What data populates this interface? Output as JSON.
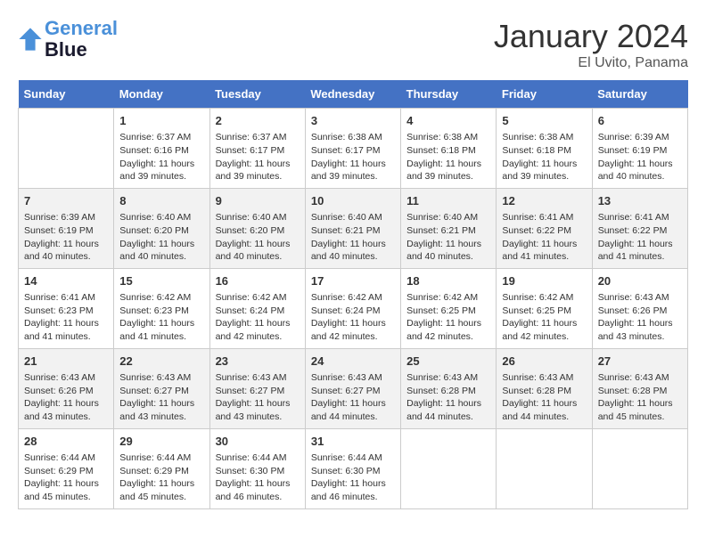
{
  "logo": {
    "line1": "General",
    "line2": "Blue"
  },
  "title": "January 2024",
  "location": "El Uvito, Panama",
  "days_of_week": [
    "Sunday",
    "Monday",
    "Tuesday",
    "Wednesday",
    "Thursday",
    "Friday",
    "Saturday"
  ],
  "weeks": [
    [
      {
        "day": "",
        "content": ""
      },
      {
        "day": "1",
        "content": "Sunrise: 6:37 AM\nSunset: 6:16 PM\nDaylight: 11 hours and 39 minutes."
      },
      {
        "day": "2",
        "content": "Sunrise: 6:37 AM\nSunset: 6:17 PM\nDaylight: 11 hours and 39 minutes."
      },
      {
        "day": "3",
        "content": "Sunrise: 6:38 AM\nSunset: 6:17 PM\nDaylight: 11 hours and 39 minutes."
      },
      {
        "day": "4",
        "content": "Sunrise: 6:38 AM\nSunset: 6:18 PM\nDaylight: 11 hours and 39 minutes."
      },
      {
        "day": "5",
        "content": "Sunrise: 6:38 AM\nSunset: 6:18 PM\nDaylight: 11 hours and 39 minutes."
      },
      {
        "day": "6",
        "content": "Sunrise: 6:39 AM\nSunset: 6:19 PM\nDaylight: 11 hours and 40 minutes."
      }
    ],
    [
      {
        "day": "7",
        "content": "Sunrise: 6:39 AM\nSunset: 6:19 PM\nDaylight: 11 hours and 40 minutes."
      },
      {
        "day": "8",
        "content": "Sunrise: 6:40 AM\nSunset: 6:20 PM\nDaylight: 11 hours and 40 minutes."
      },
      {
        "day": "9",
        "content": "Sunrise: 6:40 AM\nSunset: 6:20 PM\nDaylight: 11 hours and 40 minutes."
      },
      {
        "day": "10",
        "content": "Sunrise: 6:40 AM\nSunset: 6:21 PM\nDaylight: 11 hours and 40 minutes."
      },
      {
        "day": "11",
        "content": "Sunrise: 6:40 AM\nSunset: 6:21 PM\nDaylight: 11 hours and 40 minutes."
      },
      {
        "day": "12",
        "content": "Sunrise: 6:41 AM\nSunset: 6:22 PM\nDaylight: 11 hours and 41 minutes."
      },
      {
        "day": "13",
        "content": "Sunrise: 6:41 AM\nSunset: 6:22 PM\nDaylight: 11 hours and 41 minutes."
      }
    ],
    [
      {
        "day": "14",
        "content": "Sunrise: 6:41 AM\nSunset: 6:23 PM\nDaylight: 11 hours and 41 minutes."
      },
      {
        "day": "15",
        "content": "Sunrise: 6:42 AM\nSunset: 6:23 PM\nDaylight: 11 hours and 41 minutes."
      },
      {
        "day": "16",
        "content": "Sunrise: 6:42 AM\nSunset: 6:24 PM\nDaylight: 11 hours and 42 minutes."
      },
      {
        "day": "17",
        "content": "Sunrise: 6:42 AM\nSunset: 6:24 PM\nDaylight: 11 hours and 42 minutes."
      },
      {
        "day": "18",
        "content": "Sunrise: 6:42 AM\nSunset: 6:25 PM\nDaylight: 11 hours and 42 minutes."
      },
      {
        "day": "19",
        "content": "Sunrise: 6:42 AM\nSunset: 6:25 PM\nDaylight: 11 hours and 42 minutes."
      },
      {
        "day": "20",
        "content": "Sunrise: 6:43 AM\nSunset: 6:26 PM\nDaylight: 11 hours and 43 minutes."
      }
    ],
    [
      {
        "day": "21",
        "content": "Sunrise: 6:43 AM\nSunset: 6:26 PM\nDaylight: 11 hours and 43 minutes."
      },
      {
        "day": "22",
        "content": "Sunrise: 6:43 AM\nSunset: 6:27 PM\nDaylight: 11 hours and 43 minutes."
      },
      {
        "day": "23",
        "content": "Sunrise: 6:43 AM\nSunset: 6:27 PM\nDaylight: 11 hours and 43 minutes."
      },
      {
        "day": "24",
        "content": "Sunrise: 6:43 AM\nSunset: 6:27 PM\nDaylight: 11 hours and 44 minutes."
      },
      {
        "day": "25",
        "content": "Sunrise: 6:43 AM\nSunset: 6:28 PM\nDaylight: 11 hours and 44 minutes."
      },
      {
        "day": "26",
        "content": "Sunrise: 6:43 AM\nSunset: 6:28 PM\nDaylight: 11 hours and 44 minutes."
      },
      {
        "day": "27",
        "content": "Sunrise: 6:43 AM\nSunset: 6:28 PM\nDaylight: 11 hours and 45 minutes."
      }
    ],
    [
      {
        "day": "28",
        "content": "Sunrise: 6:44 AM\nSunset: 6:29 PM\nDaylight: 11 hours and 45 minutes."
      },
      {
        "day": "29",
        "content": "Sunrise: 6:44 AM\nSunset: 6:29 PM\nDaylight: 11 hours and 45 minutes."
      },
      {
        "day": "30",
        "content": "Sunrise: 6:44 AM\nSunset: 6:30 PM\nDaylight: 11 hours and 46 minutes."
      },
      {
        "day": "31",
        "content": "Sunrise: 6:44 AM\nSunset: 6:30 PM\nDaylight: 11 hours and 46 minutes."
      },
      {
        "day": "",
        "content": ""
      },
      {
        "day": "",
        "content": ""
      },
      {
        "day": "",
        "content": ""
      }
    ]
  ]
}
